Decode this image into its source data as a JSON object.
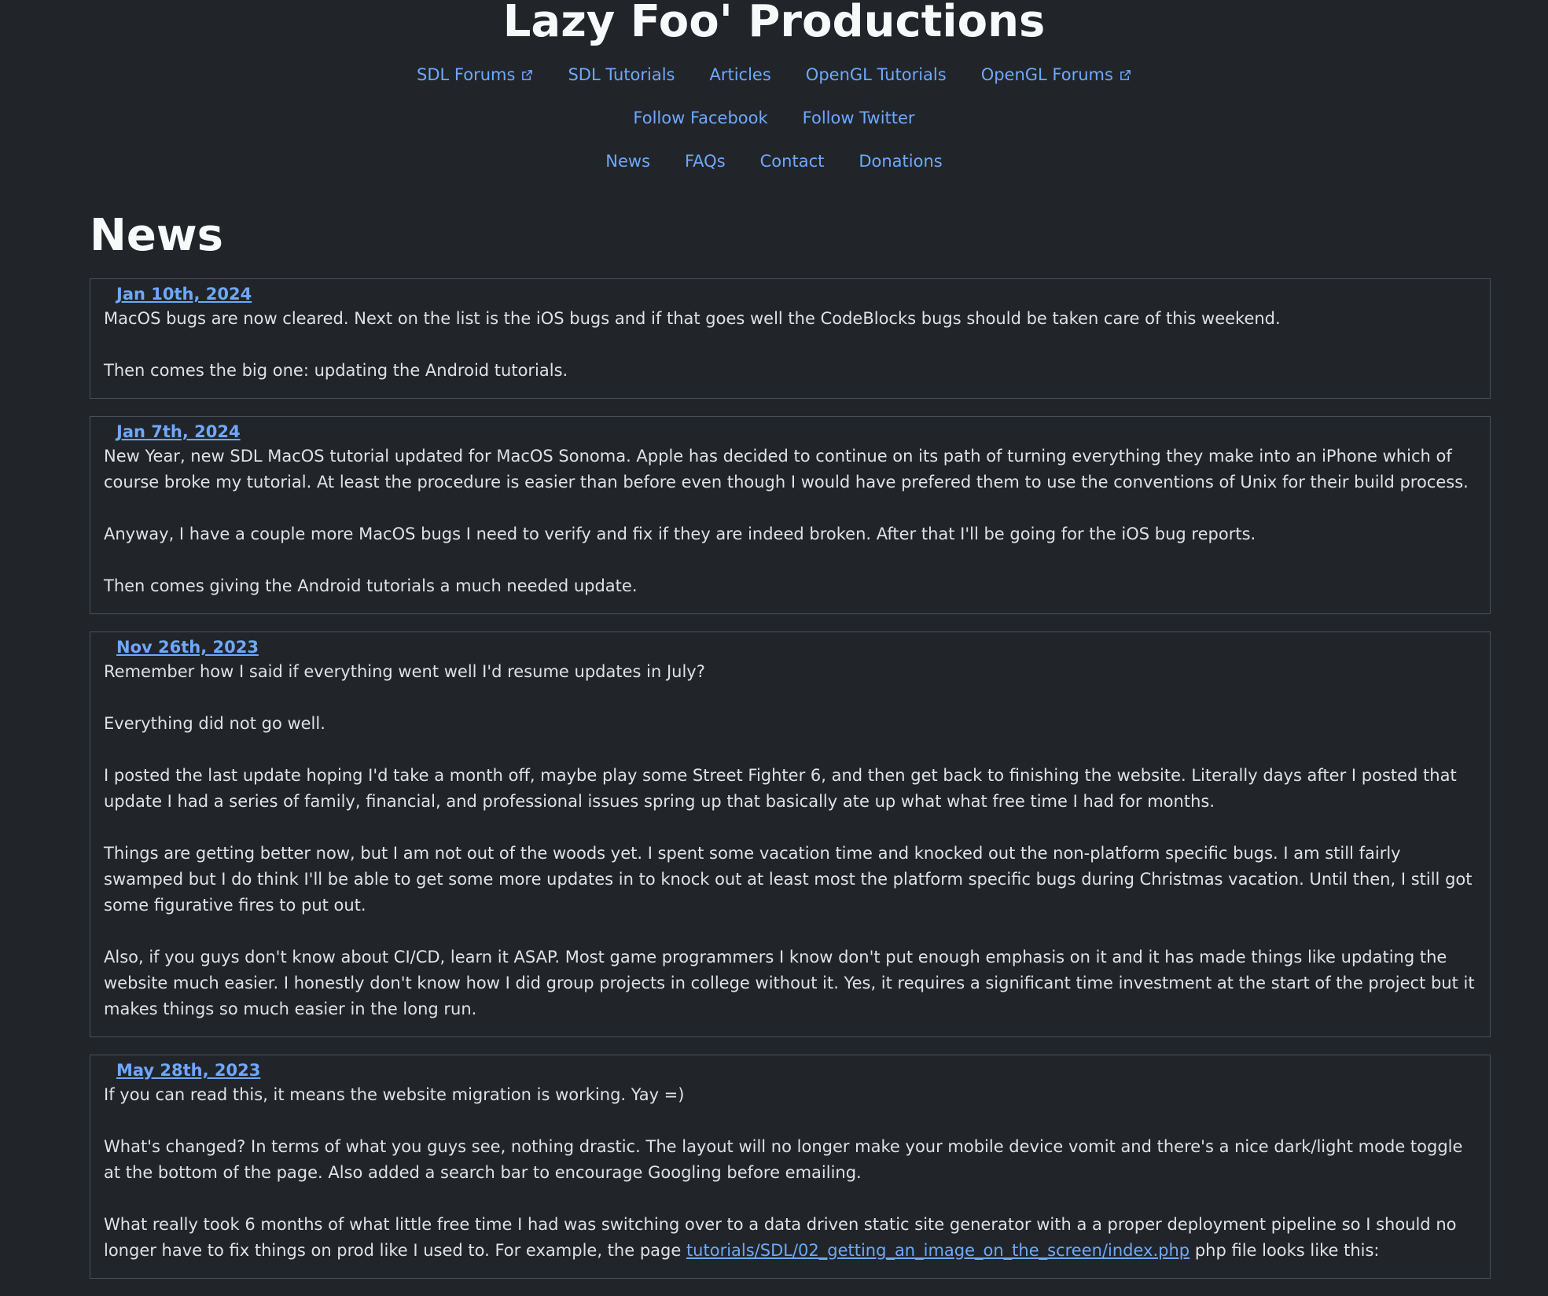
{
  "site": {
    "title": "Lazy Foo' Productions"
  },
  "nav": {
    "row1": [
      {
        "label": "SDL Forums",
        "external": true
      },
      {
        "label": "SDL Tutorials",
        "external": false
      },
      {
        "label": "Articles",
        "external": false
      },
      {
        "label": "OpenGL Tutorials",
        "external": false
      },
      {
        "label": "OpenGL Forums",
        "external": true
      }
    ],
    "row2": [
      {
        "label": "Follow Facebook"
      },
      {
        "label": "Follow Twitter"
      }
    ],
    "row3": [
      {
        "label": "News"
      },
      {
        "label": "FAQs"
      },
      {
        "label": "Contact"
      },
      {
        "label": "Donations"
      }
    ],
    "external_icon": "external-link-icon"
  },
  "page": {
    "heading": "News"
  },
  "news": [
    {
      "date": "Jan 10th, 2024",
      "paragraphs": [
        "MacOS bugs are now cleared. Next on the list is the iOS bugs and if that goes well the CodeBlocks bugs should be taken care of this weekend.",
        "Then comes the big one: updating the Android tutorials."
      ]
    },
    {
      "date": "Jan 7th, 2024",
      "paragraphs": [
        "New Year, new SDL MacOS tutorial updated for MacOS Sonoma. Apple has decided to continue on its path of turning everything they make into an iPhone which of course broke my tutorial. At least the procedure is easier than before even though I would have prefered them to use the conventions of Unix for their build process.",
        "Anyway, I have a couple more MacOS bugs I need to verify and fix if they are indeed broken. After that I'll be going for the iOS bug reports.",
        "Then comes giving the Android tutorials a much needed update."
      ]
    },
    {
      "date": "Nov 26th, 2023",
      "paragraphs": [
        "Remember how I said if everything went well I'd resume updates in July?",
        "Everything did not go well.",
        "I posted the last update hoping I'd take a month off, maybe play some Street Fighter 6, and then get back to finishing the website. Literally days after I posted that update I had a series of family, financial, and professional issues spring up that basically ate up what what free time I had for months.",
        "Things are getting better now, but I am not out of the woods yet. I spent some vacation time and knocked out the non-platform specific bugs. I am still fairly swamped but I do think I'll be able to get some more updates in to knock out at least most the platform specific bugs during Christmas vacation. Until then, I still got some figurative fires to put out.",
        "Also, if you guys don't know about CI/CD, learn it ASAP. Most game programmers I know don't put enough emphasis on it and it has made things like updating the website much easier. I honestly don't know how I did group projects in college without it. Yes, it requires a significant time investment at the start of the project but it makes things so much easier in the long run."
      ]
    },
    {
      "date": "May 28th, 2023",
      "paragraphs": [
        "If you can read this, it means the website migration is working. Yay =)",
        "What's changed? In terms of what you guys see, nothing drastic. The layout will no longer make your mobile device vomit and there's a nice dark/light mode toggle at the bottom of the page. Also added a search bar to encourage Googling before emailing."
      ],
      "last_para": {
        "before": "What really took 6 months of what little free time I had was switching over to a data driven static site generator with a a proper deployment pipeline so I should no longer have to fix things on prod like I used to. For example, the page ",
        "link": "tutorials/SDL/02_getting_an_image_on_the_screen/index.php",
        "after": " php file looks like this:"
      }
    }
  ]
}
